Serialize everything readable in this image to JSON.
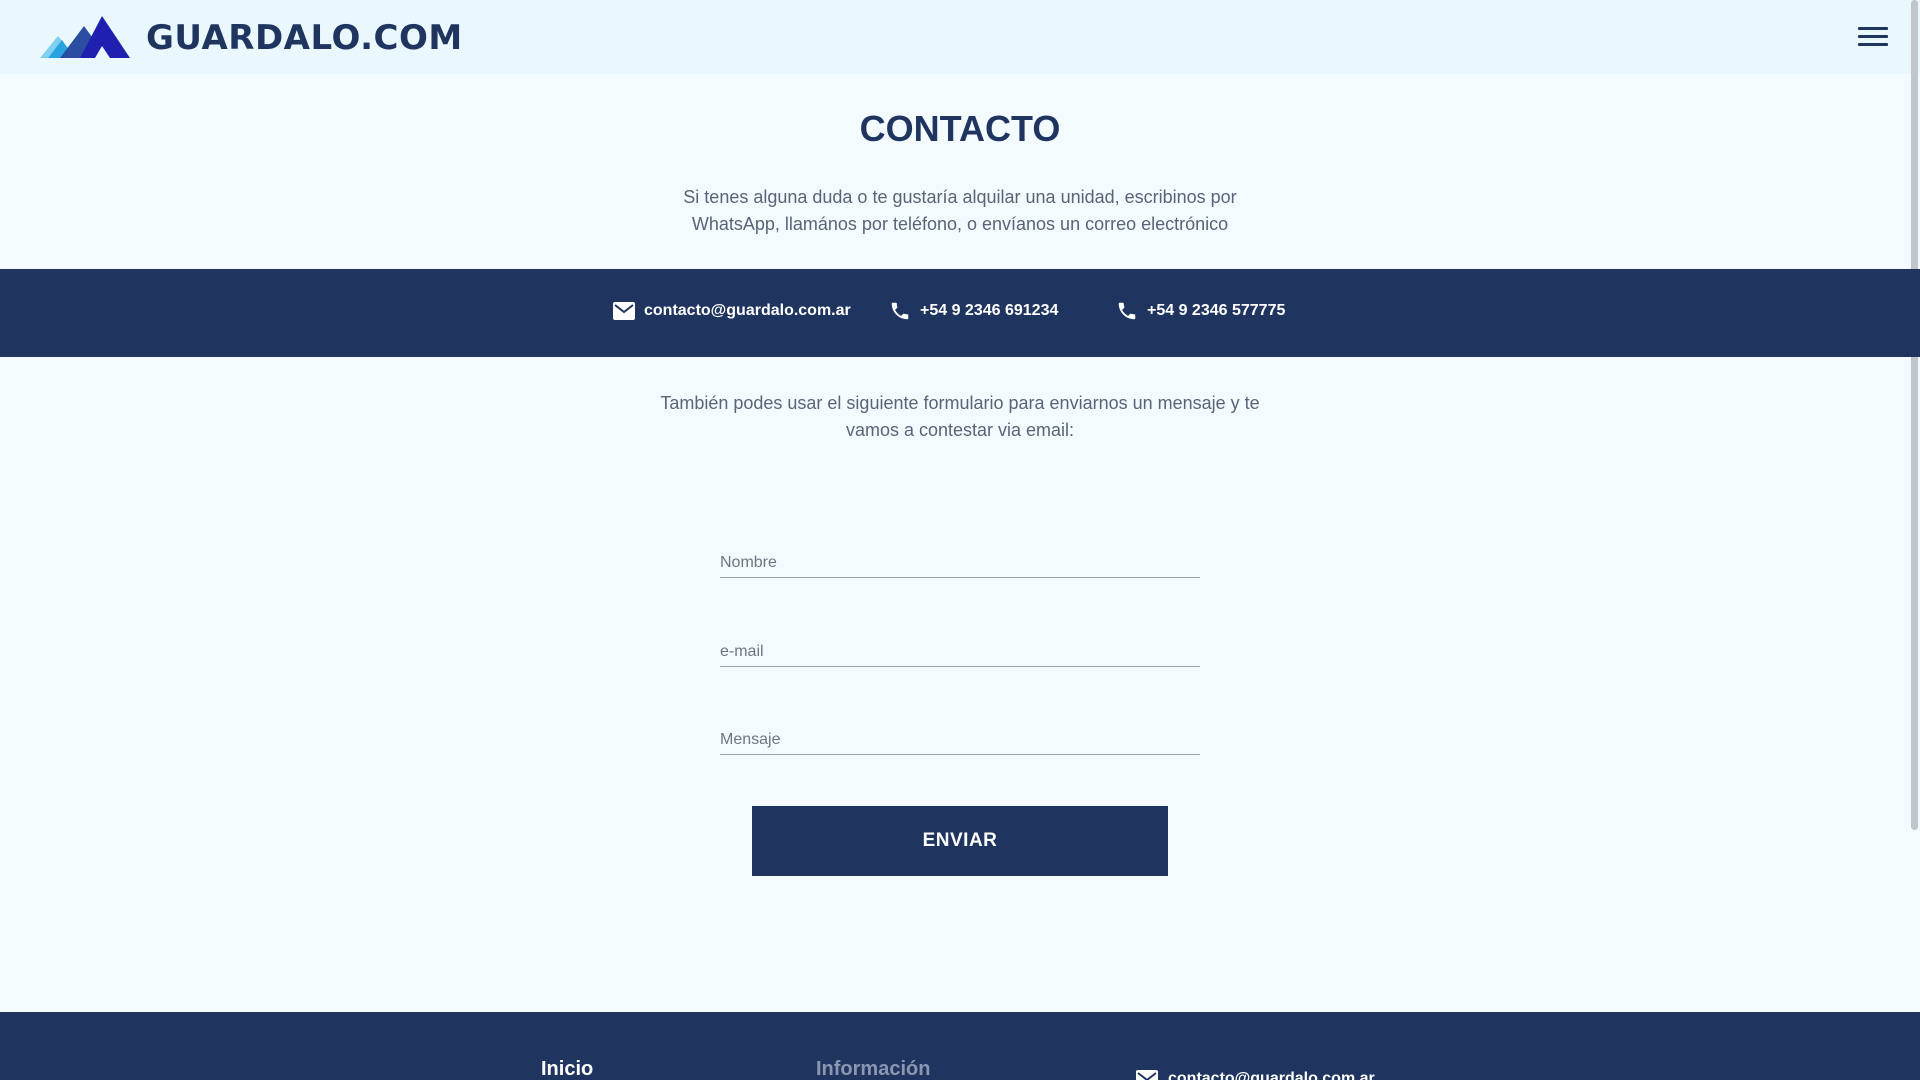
{
  "header": {
    "brand": "GUARDALO.COM",
    "menu_icon": "hamburger-menu-icon"
  },
  "page": {
    "title": "CONTACTO",
    "intro": "Si tenes alguna duda o te gustaría alquilar una unidad, escribinos por WhatsApp, llamános por teléfono, o envíanos un correo electrónico"
  },
  "contact_band": {
    "email": {
      "icon": "mail-icon",
      "text": "contacto@guardalo.com.ar"
    },
    "phone1": {
      "icon": "phone-icon",
      "text": "+54 9 2346 691234"
    },
    "phone2": {
      "icon": "phone-icon",
      "text": "+54 9 2346 577775"
    }
  },
  "form": {
    "intro": "También podes usar el siguiente formulario para enviarnos un mensaje y te vamos a contestar via email:",
    "name_placeholder": "Nombre",
    "email_placeholder": "e-mail",
    "message_placeholder": "Mensaje",
    "submit_label": "ENVIAR"
  },
  "footer": {
    "links": [
      "Inicio",
      "Información"
    ],
    "email": "contacto@guardalo.com.ar"
  },
  "colors": {
    "primary": "#1f3560",
    "background": "#f3fbfe",
    "header_bg": "#eaf8fd",
    "muted_text": "#5a6477",
    "logo_blue": "#1f1fb0",
    "logo_light": "#29a3e0"
  }
}
